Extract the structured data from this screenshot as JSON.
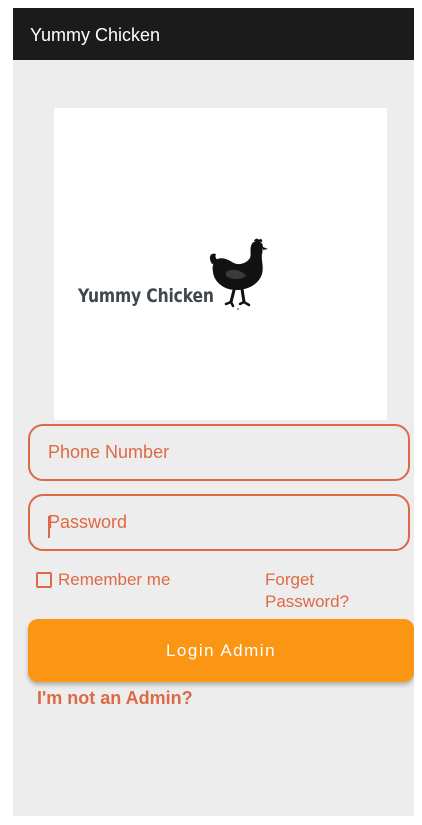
{
  "appbar": {
    "title": "Yummy Chicken"
  },
  "logo": {
    "text": "Yummy Chicken"
  },
  "form": {
    "phone_placeholder": "Phone Number",
    "phone_value": "",
    "password_placeholder": "Password",
    "password_value": "",
    "remember_label": "Remember me",
    "remember_checked": false,
    "forget_label": "Forget Password?",
    "login_label": "Login Admin",
    "not_admin_label": "I'm not an Admin?"
  },
  "colors": {
    "accent": "#de6a45",
    "button": "#fb9614",
    "appbar": "#1b1b1b",
    "background": "#ededed"
  },
  "icons": [
    "hen-logo-icon",
    "checkbox-icon"
  ]
}
